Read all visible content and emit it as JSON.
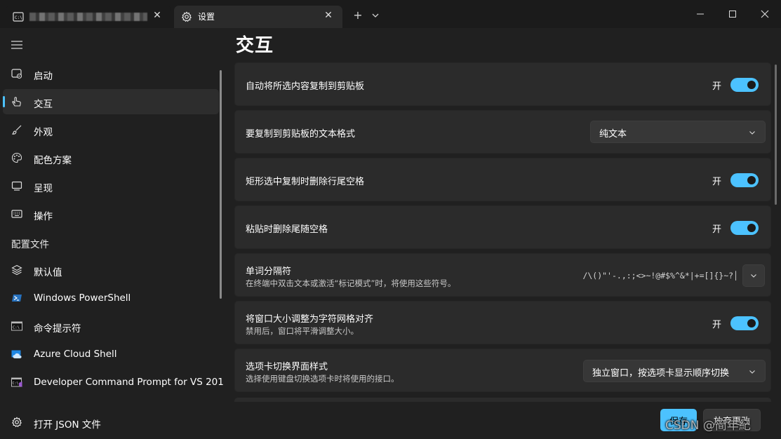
{
  "tabs": {
    "inactive_close": "✕",
    "active_title": "设置",
    "active_close": "✕",
    "new_tab": "+",
    "dropdown": "⌵"
  },
  "page": {
    "title": "交互"
  },
  "sidebar": {
    "items": [
      {
        "label": "启动",
        "icon": "startup-icon"
      },
      {
        "label": "交互",
        "icon": "interaction-icon"
      },
      {
        "label": "外观",
        "icon": "brush-icon"
      },
      {
        "label": "配色方案",
        "icon": "palette-icon"
      },
      {
        "label": "呈现",
        "icon": "monitor-icon"
      },
      {
        "label": "操作",
        "icon": "keyboard-icon"
      }
    ],
    "profiles_header": "配置文件",
    "profiles": [
      {
        "label": "默认值",
        "icon": "layers-icon"
      },
      {
        "label": "Windows PowerShell",
        "icon": "powershell-icon"
      },
      {
        "label": "命令提示符",
        "icon": "cmd-icon"
      },
      {
        "label": "Azure Cloud Shell",
        "icon": "azure-icon"
      },
      {
        "label": "Developer Command Prompt for VS 201",
        "icon": "vs-cmd-icon"
      }
    ],
    "footer": "打开 JSON 文件"
  },
  "settings": {
    "copy_on_select": {
      "label": "自动将所选内容复制到剪贴板",
      "state": "开"
    },
    "copy_format": {
      "label": "要复制到剪贴板的文本格式",
      "value": "纯文本"
    },
    "trim_block": {
      "label": "矩形选中复制时删除行尾空格",
      "state": "开"
    },
    "trim_paste": {
      "label": "粘贴时删除尾随空格",
      "state": "开"
    },
    "word_delimiters": {
      "label": "单词分隔符",
      "desc": "在终端中双击文本或激活“标记模式”时，将使用这些符号。",
      "value": "/\\()\"'-.,:;<>~!@#$%^&*|+=[]{}~?│"
    },
    "snap_resize": {
      "label": "将窗口大小调整为字符网格对齐",
      "desc": "禁用后，窗口将平滑调整大小。",
      "state": "开"
    },
    "tab_switcher": {
      "label": "选项卡切换界面样式",
      "desc": "选择使用键盘切换选项卡时将使用的接口。",
      "value": "独立窗口，按选项卡显示顺序切换"
    }
  },
  "buttons": {
    "save": "保存",
    "discard": "放弃更改"
  },
  "watermark": "CSDN @简年紀",
  "colors": {
    "accent": "#4cc2ff",
    "background": "#202020",
    "card": "#2b2b2b"
  }
}
